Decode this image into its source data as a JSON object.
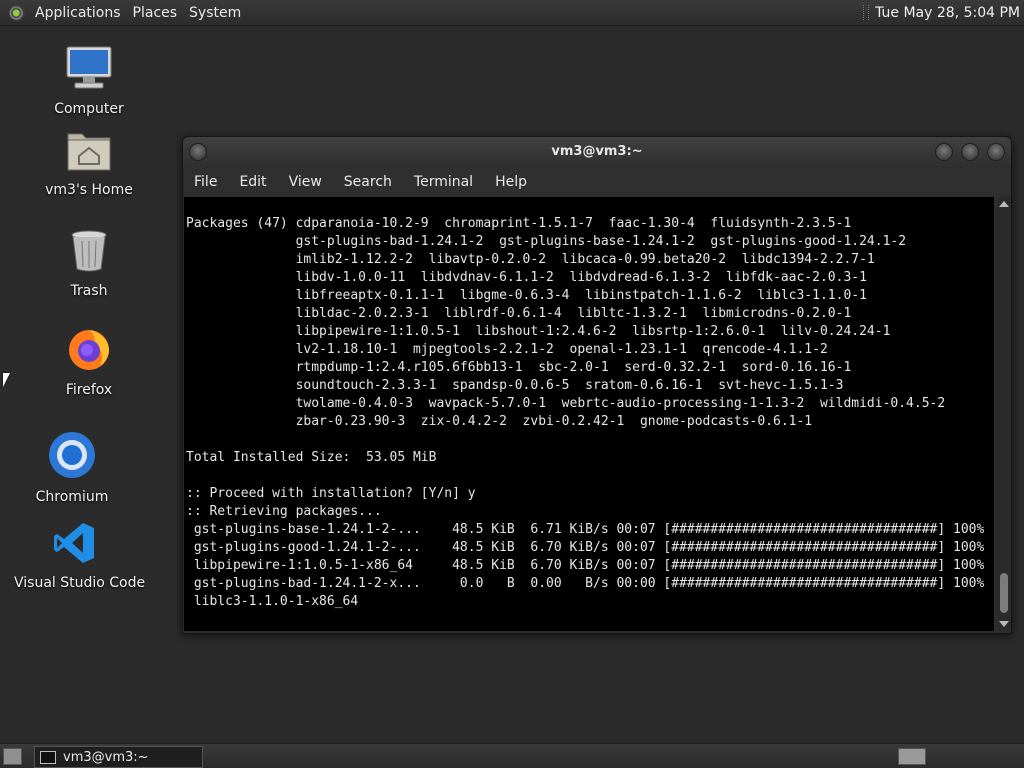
{
  "top_panel": {
    "menus": [
      "Applications",
      "Places",
      "System"
    ],
    "clock": "Tue May 28,  5:04 PM"
  },
  "desktop": {
    "icons": [
      {
        "label": "Computer",
        "icon": "computer-icon"
      },
      {
        "label": "vm3's Home",
        "icon": "home-folder-icon"
      },
      {
        "label": "Trash",
        "icon": "trash-icon"
      },
      {
        "label": "Firefox",
        "icon": "firefox-icon"
      },
      {
        "label": "Chromium",
        "icon": "chromium-icon"
      },
      {
        "label": "Visual Studio Code",
        "icon": "vscode-icon"
      }
    ]
  },
  "terminal_window": {
    "title": "vm3@vm3:~",
    "menus": [
      "File",
      "Edit",
      "View",
      "Search",
      "Terminal",
      "Help"
    ],
    "lines": [
      "Packages (47) cdparanoia-10.2-9  chromaprint-1.5.1-7  faac-1.30-4  fluidsynth-2.3.5-1",
      "              gst-plugins-bad-1.24.1-2  gst-plugins-base-1.24.1-2  gst-plugins-good-1.24.1-2",
      "              imlib2-1.12.2-2  libavtp-0.2.0-2  libcaca-0.99.beta20-2  libdc1394-2.2.7-1",
      "              libdv-1.0.0-11  libdvdnav-6.1.1-2  libdvdread-6.1.3-2  libfdk-aac-2.0.3-1",
      "              libfreeaptx-0.1.1-1  libgme-0.6.3-4  libinstpatch-1.1.6-2  liblc3-1.1.0-1",
      "              libldac-2.0.2.3-1  liblrdf-0.6.1-4  libltc-1.3.2-1  libmicrodns-0.2.0-1",
      "              libpipewire-1:1.0.5-1  libshout-1:2.4.6-2  libsrtp-1:2.6.0-1  lilv-0.24.24-1",
      "              lv2-1.18.10-1  mjpegtools-2.2.1-2  openal-1.23.1-1  qrencode-4.1.1-2",
      "              rtmpdump-1:2.4.r105.6f6bb13-1  sbc-2.0-1  serd-0.32.2-1  sord-0.16.16-1",
      "              soundtouch-2.3.3-1  spandsp-0.0.6-5  sratom-0.6.16-1  svt-hevc-1.5.1-3",
      "              twolame-0.4.0-3  wavpack-5.7.0-1  webrtc-audio-processing-1-1.3-2  wildmidi-0.4.5-2",
      "              zbar-0.23.90-3  zix-0.4.2-2  zvbi-0.2.42-1  gnome-podcasts-0.6.1-1",
      "",
      "Total Installed Size:  53.05 MiB",
      "",
      ":: Proceed with installation? [Y/n] y",
      ":: Retrieving packages...",
      " gst-plugins-base-1.24.1-2-...    48.5 KiB  6.71 KiB/s 00:07 [##################################] 100%",
      " gst-plugins-good-1.24.1-2-...    48.5 KiB  6.70 KiB/s 00:07 [##################################] 100%",
      " libpipewire-1:1.0.5-1-x86_64     48.5 KiB  6.70 KiB/s 00:07 [##################################] 100%",
      " gst-plugins-bad-1.24.1-2-x...     0.0   B  0.00   B/s 00:00 [##################################] 100%",
      " liblc3-1.1.0-1-x86_64"
    ]
  },
  "bottom_panel": {
    "task_label": "vm3@vm3:~"
  }
}
